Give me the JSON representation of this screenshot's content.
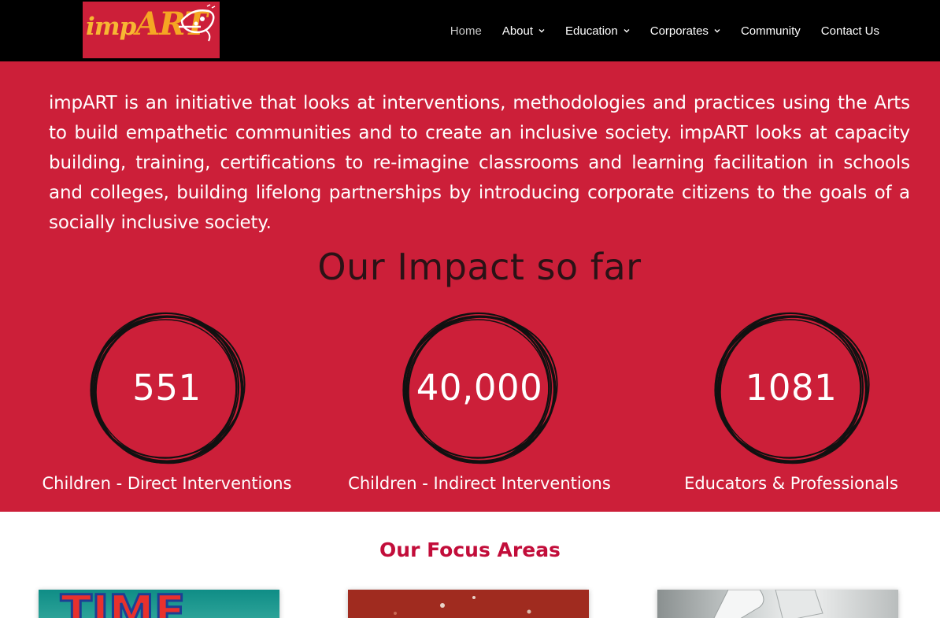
{
  "brand": {
    "logo_text": "impART",
    "logo_alt": "impART logo"
  },
  "nav": {
    "items": [
      {
        "label": "Home",
        "active": true,
        "has_dropdown": false
      },
      {
        "label": "About",
        "active": false,
        "has_dropdown": true
      },
      {
        "label": "Education",
        "active": false,
        "has_dropdown": true
      },
      {
        "label": "Corporates",
        "active": false,
        "has_dropdown": true
      },
      {
        "label": "Community",
        "active": false,
        "has_dropdown": false
      },
      {
        "label": "Contact Us",
        "active": false,
        "has_dropdown": false
      }
    ]
  },
  "intro": {
    "text": "impART is an initiative that looks at interventions, methodologies and practices using the Arts to build empathetic communities and to create an inclusive society. impART looks at capacity building, training, certifications to re-imagine classrooms and learning facilitation in schools and colleges, building lifelong partnerships by introducing corporate citizens to the goals of a socially inclusive society."
  },
  "impact": {
    "title": "Our Impact so far",
    "stats": [
      {
        "value": "551",
        "label": "Children - Direct Interventions"
      },
      {
        "value": "40,000",
        "label": "Children - Indirect Interventions"
      },
      {
        "value": "1081",
        "label": "Educators & Professionals"
      }
    ]
  },
  "focus": {
    "title": "Our Focus Areas",
    "cards": [
      {
        "name": "focus-card-1",
        "image": "colorful-letters-image"
      },
      {
        "name": "focus-card-2",
        "image": "red-clay-image"
      },
      {
        "name": "focus-card-3",
        "image": "puzzle-pieces-image"
      }
    ]
  },
  "colors": {
    "header_bg": "#000000",
    "brand_red": "#cc1f39",
    "heading_dark": "#2b1216",
    "focus_title": "#c20d3a",
    "logo_orange": "#f5a623"
  }
}
